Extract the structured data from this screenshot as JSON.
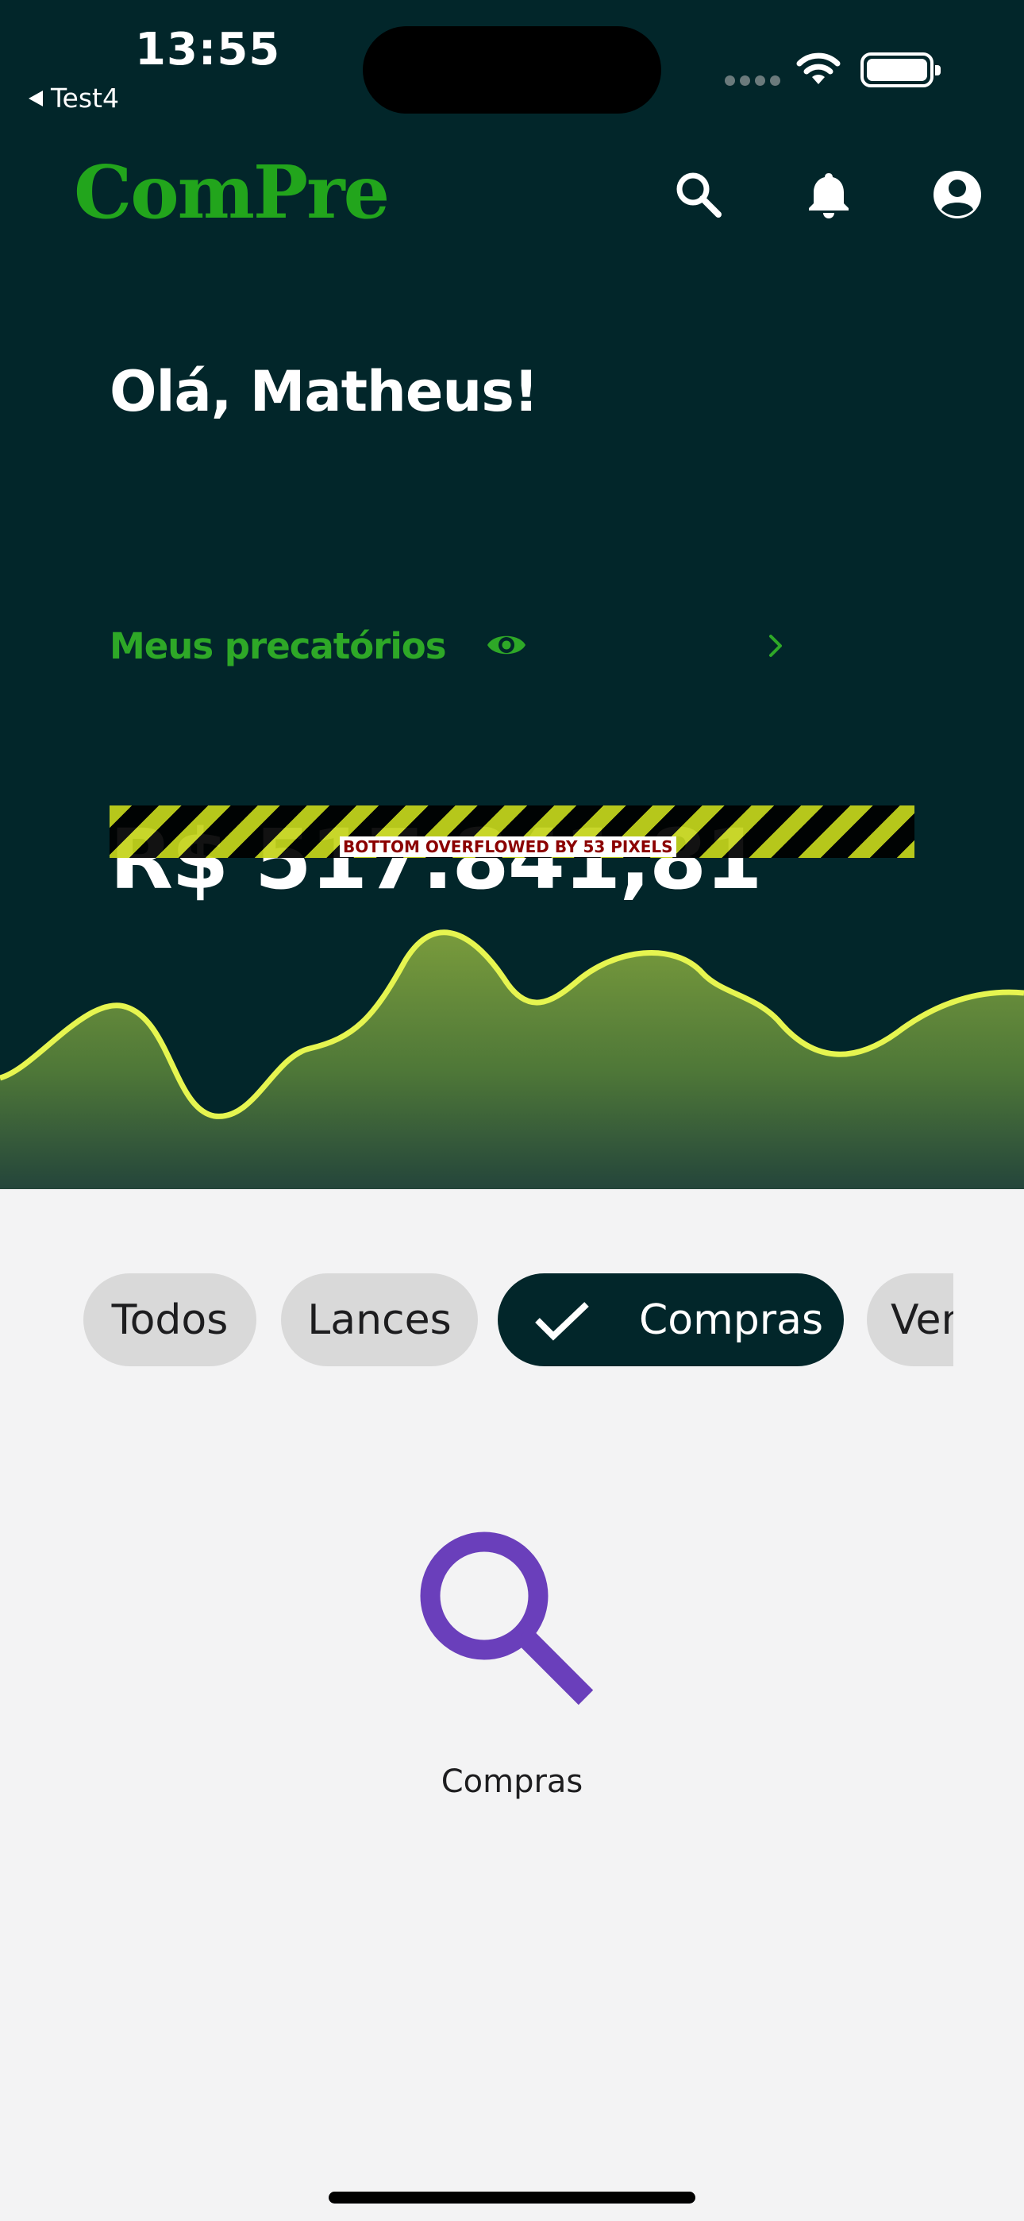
{
  "status_bar": {
    "time": "13:55",
    "back_app": "Test4"
  },
  "header": {
    "brand": "ComPre"
  },
  "greeting": "Olá, Matheus!",
  "precatorios": {
    "label": "Meus precatórios"
  },
  "balance": "R$ 517.841,81",
  "debug_overflow": "BOTTOM OVERFLOWED BY 53 PIXELS",
  "filters": {
    "chips": [
      "Todos",
      "Lances",
      "Compras",
      "Vendas"
    ],
    "selected": "Compras"
  },
  "empty_state": {
    "label": "Compras"
  },
  "colors": {
    "hero_bg": "#02262a",
    "brand_green": "#22a51c",
    "chart_line": "#e6f550",
    "empty_icon": "#6a3fbb",
    "page_bg": "#f3f3f4"
  },
  "icons": [
    "search-icon",
    "bell-icon",
    "profile-icon",
    "eye-icon",
    "chevron-right-icon",
    "check-icon",
    "magnifier-icon"
  ]
}
